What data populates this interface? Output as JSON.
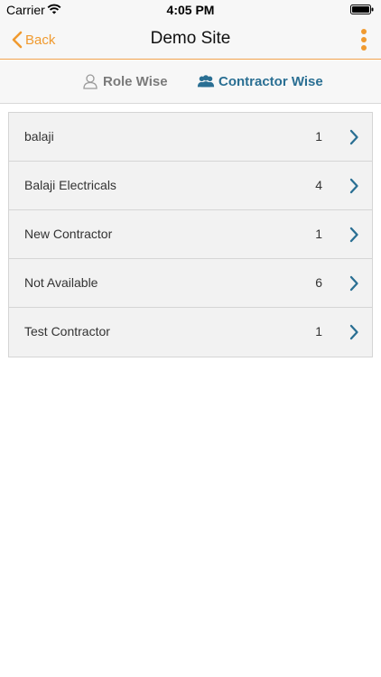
{
  "status_bar": {
    "carrier": "Carrier",
    "time": "4:05 PM",
    "icons": [
      "wifi-icon",
      "battery-icon"
    ]
  },
  "nav": {
    "back_label": "Back",
    "title": "Demo Site",
    "accent_color": "#f09a2f",
    "icons": [
      "chevron-left-icon",
      "more-vertical-icon"
    ]
  },
  "segments": {
    "role_label": "Role Wise",
    "contractor_label": "Contractor Wise",
    "active": "Contractor Wise",
    "active_color": "#2a6f93",
    "icons": [
      "person-icon",
      "group-icon"
    ]
  },
  "contractors": [
    {
      "name": "balaji",
      "count": "1"
    },
    {
      "name": "Balaji Electricals",
      "count": "4"
    },
    {
      "name": "New Contractor",
      "count": "1"
    },
    {
      "name": "Not Available",
      "count": "6"
    },
    {
      "name": "Test Contractor",
      "count": "1"
    }
  ]
}
